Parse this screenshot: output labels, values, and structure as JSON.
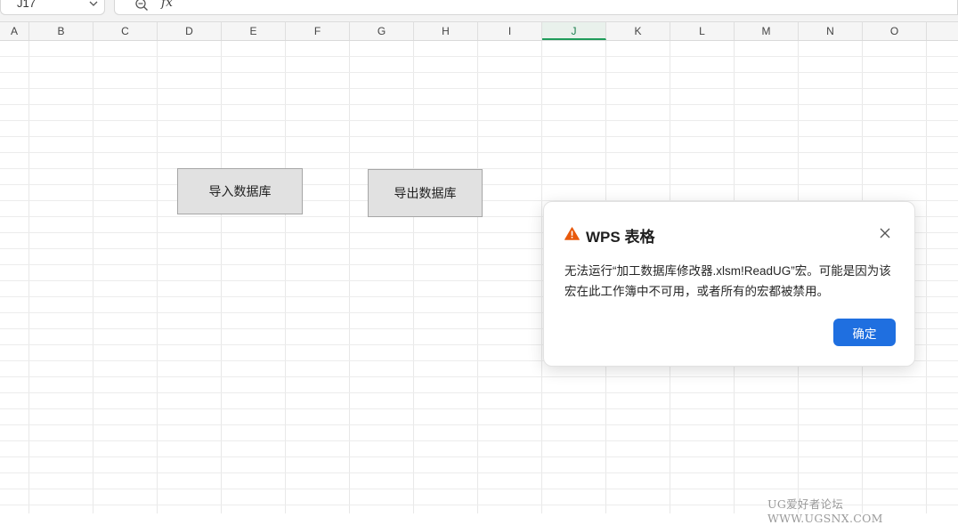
{
  "formula_bar": {
    "name_box_value": "J17",
    "fx_label": "fx"
  },
  "columns": [
    "A",
    "B",
    "C",
    "D",
    "E",
    "F",
    "G",
    "H",
    "I",
    "J",
    "K",
    "L",
    "M",
    "N",
    "O"
  ],
  "active_column": "J",
  "sheet_buttons": {
    "import": "导入数据库",
    "export": "导出数据库"
  },
  "dialog": {
    "title": "WPS 表格",
    "message": "无法运行“加工数据库修改器.xlsm!ReadUG”宏。可能是因为该宏在此工作簿中不可用，或者所有的宏都被禁用。",
    "ok_label": "确定",
    "warning_color": "#e8590c",
    "ok_color": "#1f6fe0"
  },
  "watermark": "UG爱好者论坛 WWW.UGSNX.COM"
}
